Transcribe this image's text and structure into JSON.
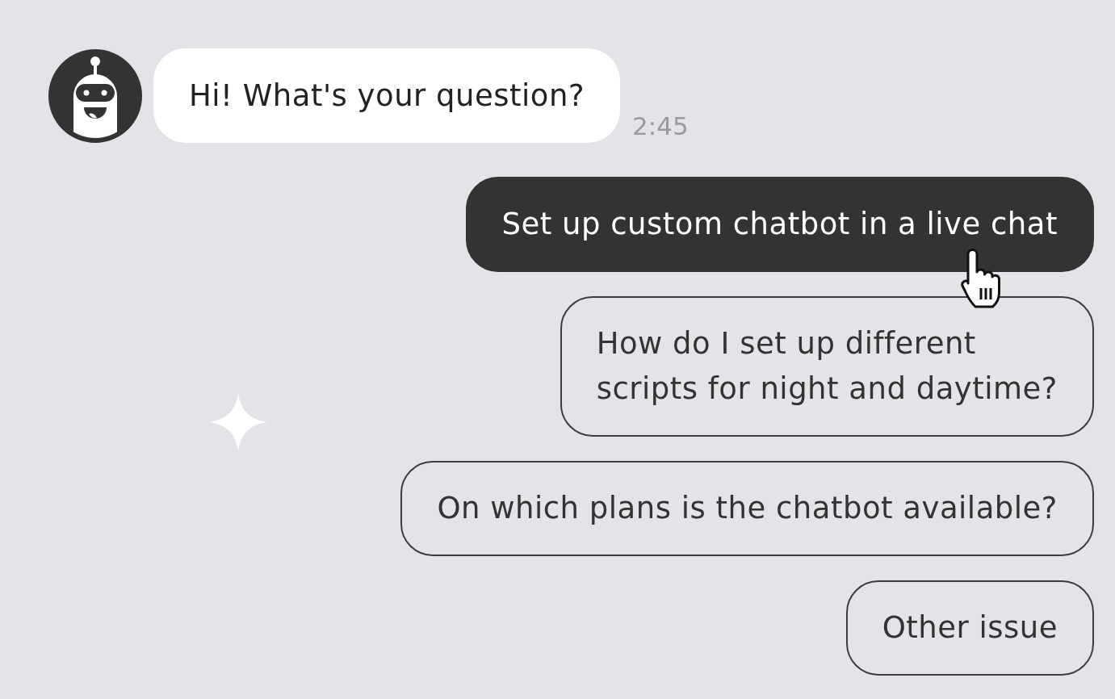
{
  "bot_message": {
    "text": "Hi! What's your question?",
    "time": "2:45"
  },
  "options": [
    {
      "label": "Set up custom chatbot in a live chat",
      "selected": true
    },
    {
      "label": "How do I set up different\nscripts for night and daytime?",
      "selected": false
    },
    {
      "label": "On which plans is the chatbot available?",
      "selected": false
    },
    {
      "label": "Other issue",
      "selected": false
    }
  ]
}
